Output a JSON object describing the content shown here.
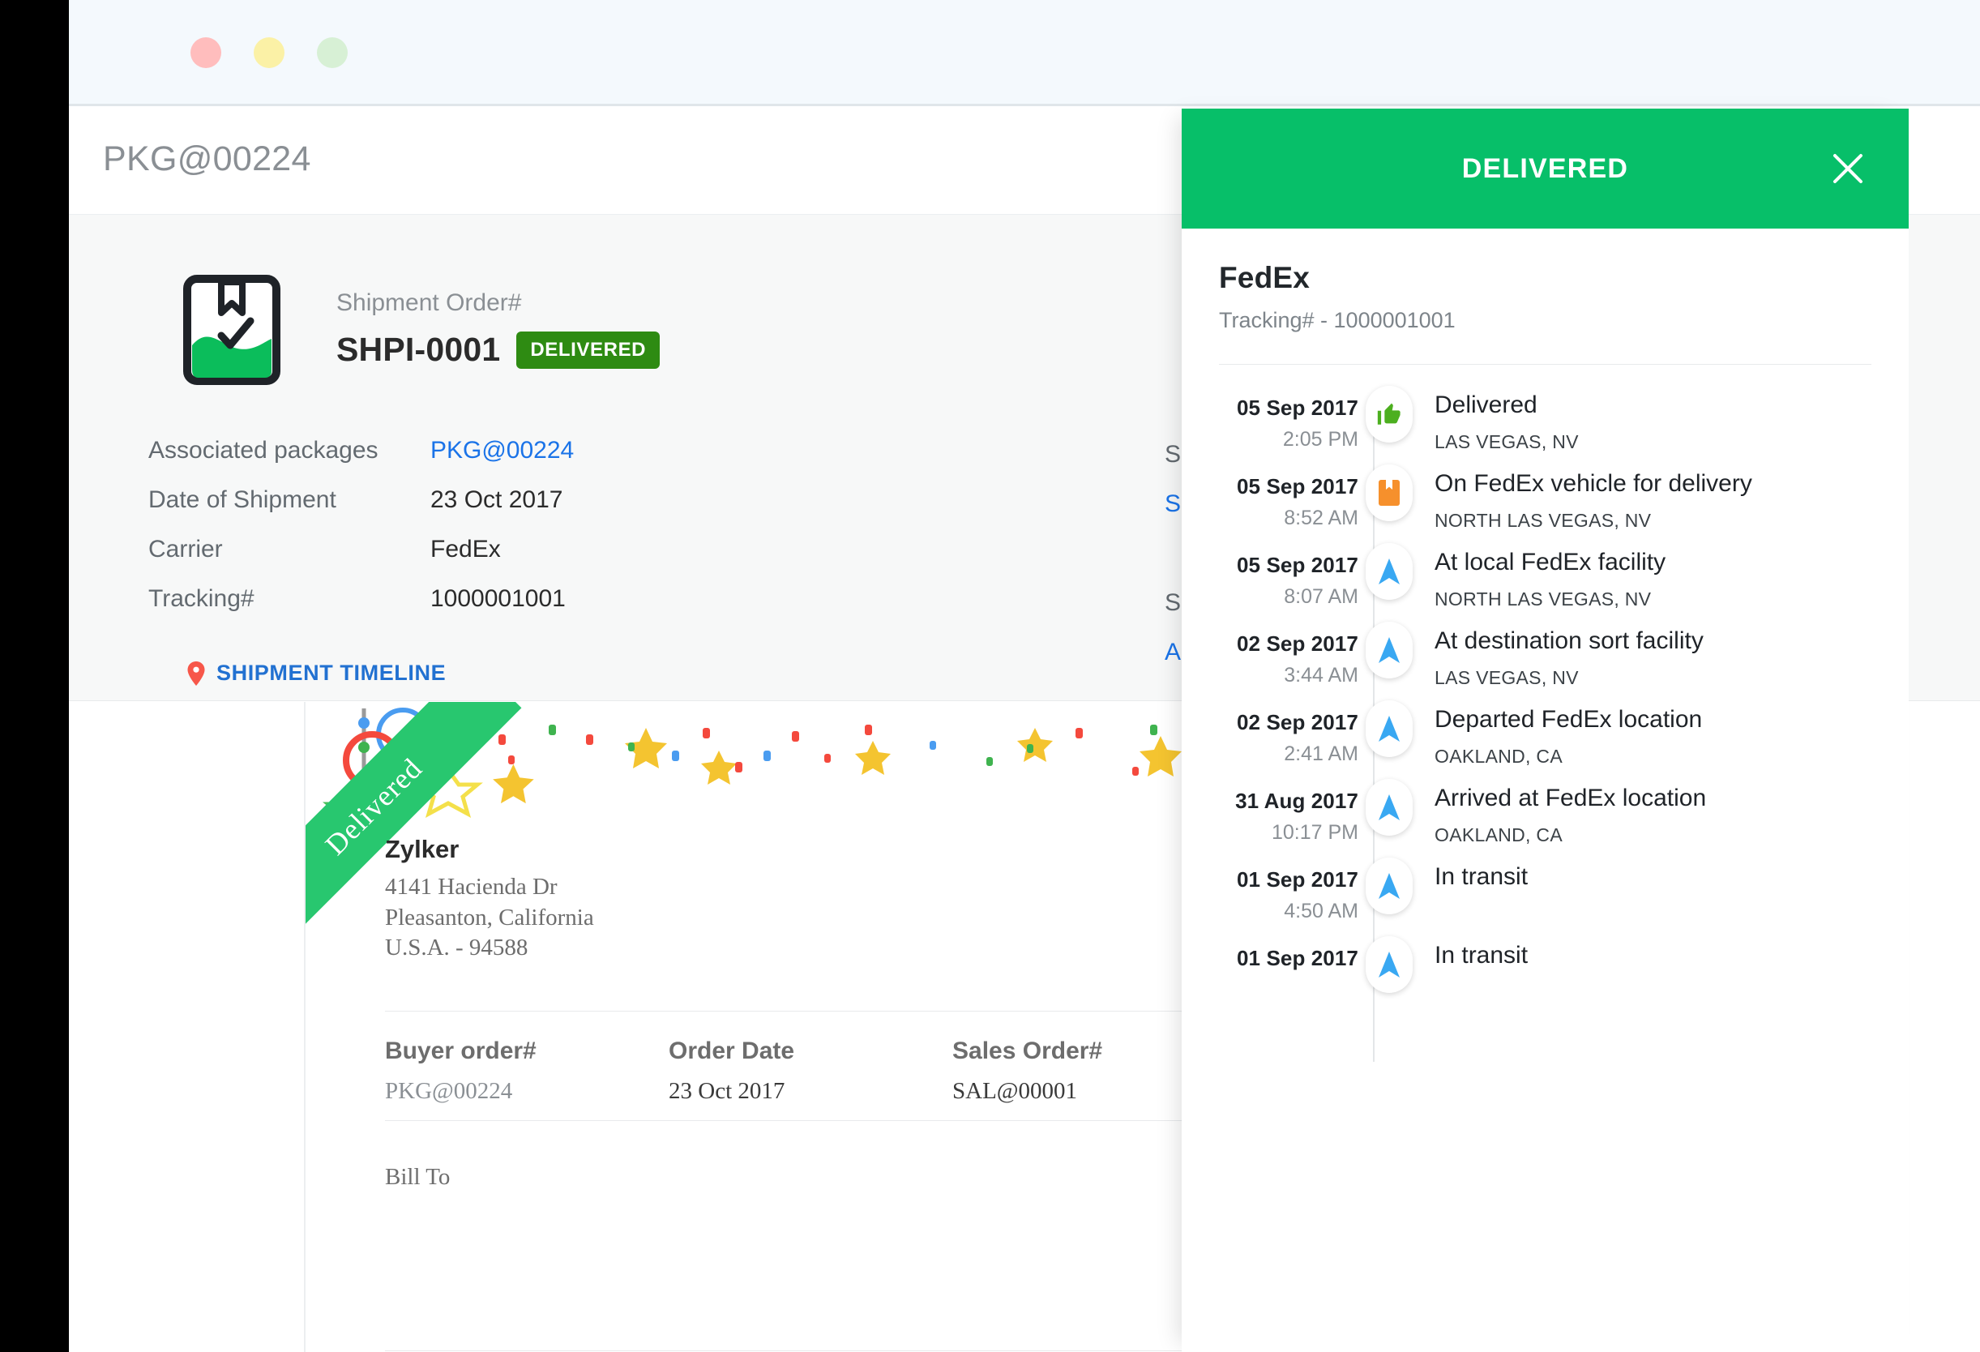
{
  "window": {
    "dots": [
      "close-dot",
      "minimize-dot",
      "maximize-dot"
    ]
  },
  "header": {
    "title": "PKG@00224"
  },
  "summary": {
    "shipment_order_label": "Shipment Order#",
    "shipment_order_number": "SHPI-0001",
    "status_badge": "DELIVERED",
    "badge_color": "#2e8b12",
    "fields": [
      {
        "key": "Associated packages",
        "value": "PKG@00224",
        "is_link": true
      },
      {
        "key": "Date of Shipment",
        "value": "23 Oct 2017",
        "is_link": false
      },
      {
        "key": "Carrier",
        "value": "FedEx",
        "is_link": false
      },
      {
        "key": "Tracking#",
        "value": "1000001001",
        "is_link": false
      }
    ],
    "timeline_link": "SHIPMENT TIMELINE",
    "obscured_column": [
      {
        "text": "S",
        "is_link": false
      },
      {
        "text": "S",
        "is_link": true
      },
      {
        "text": "",
        "is_link": false
      },
      {
        "text": "S",
        "is_link": false
      },
      {
        "text": "A",
        "is_link": true
      }
    ]
  },
  "document": {
    "ribbon_text": "Delivered",
    "ribbon_color": "#28c76f",
    "address": {
      "name": "Zylker",
      "lines": [
        "4141 Hacienda Dr",
        "Pleasanton, California",
        "U.S.A. - 94588"
      ]
    },
    "order_table": {
      "headers": [
        "Buyer order#",
        "Order Date",
        "Sales Order#"
      ],
      "values": [
        "PKG@00224",
        "23 Oct 2017",
        "SAL@00001"
      ]
    },
    "bill_to_label": "Bill To"
  },
  "panel": {
    "status_title": "DELIVERED",
    "header_color": "#07bf69",
    "close_icon": "close-icon",
    "carrier": "FedEx",
    "tracking_line": "Tracking# - 1000001001",
    "events": [
      {
        "date": "05 Sep 2017",
        "time": "2:05 PM",
        "status": "Delivered",
        "place": "LAS VEGAS, NV",
        "icon": "thumbs-up-icon"
      },
      {
        "date": "05 Sep 2017",
        "time": "8:52 AM",
        "status": "On FedEx vehicle for delivery",
        "place": "NORTH LAS VEGAS, NV",
        "icon": "package-icon"
      },
      {
        "date": "05 Sep 2017",
        "time": "8:07 AM",
        "status": "At local FedEx facility",
        "place": "NORTH LAS VEGAS, NV",
        "icon": "arrow-up-icon"
      },
      {
        "date": "02 Sep 2017",
        "time": "3:44 AM",
        "status": "At destination sort facility",
        "place": "LAS VEGAS, NV",
        "icon": "arrow-up-icon"
      },
      {
        "date": "02 Sep 2017",
        "time": "2:41 AM",
        "status": "Departed FedEx location",
        "place": "OAKLAND, CA",
        "icon": "arrow-up-icon"
      },
      {
        "date": "31 Aug 2017",
        "time": "10:17 PM",
        "status": "Arrived at FedEx location",
        "place": "OAKLAND, CA",
        "icon": "arrow-up-icon"
      },
      {
        "date": "01 Sep 2017",
        "time": "4:50 AM",
        "status": "In transit",
        "place": "",
        "icon": "arrow-up-icon"
      },
      {
        "date": "01 Sep 2017",
        "time": "",
        "status": "In transit",
        "place": "",
        "icon": "arrow-up-icon"
      }
    ]
  }
}
